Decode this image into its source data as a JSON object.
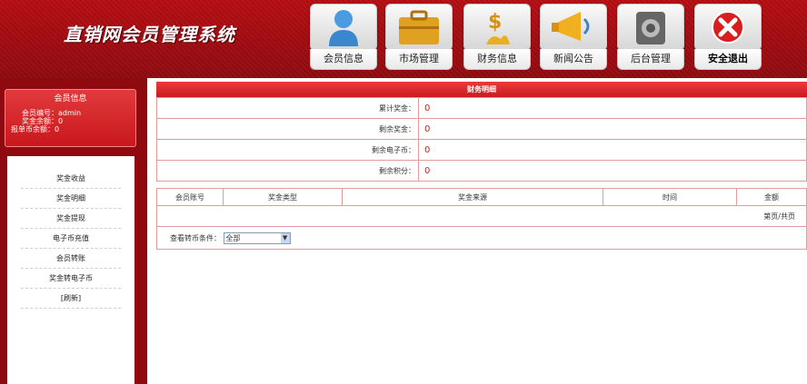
{
  "header": {
    "title": "直销网会员管理系统",
    "nav": [
      {
        "label": "会员信息",
        "icon": "user-icon"
      },
      {
        "label": "市场管理",
        "icon": "briefcase-icon"
      },
      {
        "label": "财务信息",
        "icon": "money-icon"
      },
      {
        "label": "新闻公告",
        "icon": "megaphone-icon"
      },
      {
        "label": "后台管理",
        "icon": "safe-icon"
      },
      {
        "label": "安全退出",
        "icon": "close-icon"
      }
    ]
  },
  "sidebar": {
    "user_box": {
      "title": "会员信息",
      "rows": [
        "会员编号：admin",
        "奖金余额：0",
        "报单币余额：0"
      ]
    },
    "items": [
      "奖金收益",
      "奖金明细",
      "奖金提现",
      "电子币充值",
      "会员转账",
      "奖金转电子币",
      "[刷新]"
    ]
  },
  "main": {
    "section_title": "财务明细",
    "summary": [
      {
        "label": "累计奖金：",
        "value": "0"
      },
      {
        "label": "剩余奖金：",
        "value": "0"
      },
      {
        "label": "剩余电子币：",
        "value": "0"
      },
      {
        "label": "剩余积分：",
        "value": "0"
      }
    ],
    "table": {
      "columns": [
        "会员账号",
        "奖金类型",
        "奖金来源",
        "时间",
        "金额"
      ]
    },
    "pager": "第页/共页",
    "filter_label": "查看转币条件：",
    "filter_value": "全部"
  },
  "colors": {
    "brand": "#b40d12",
    "accent": "#d32020",
    "border": "#e49a9a"
  }
}
